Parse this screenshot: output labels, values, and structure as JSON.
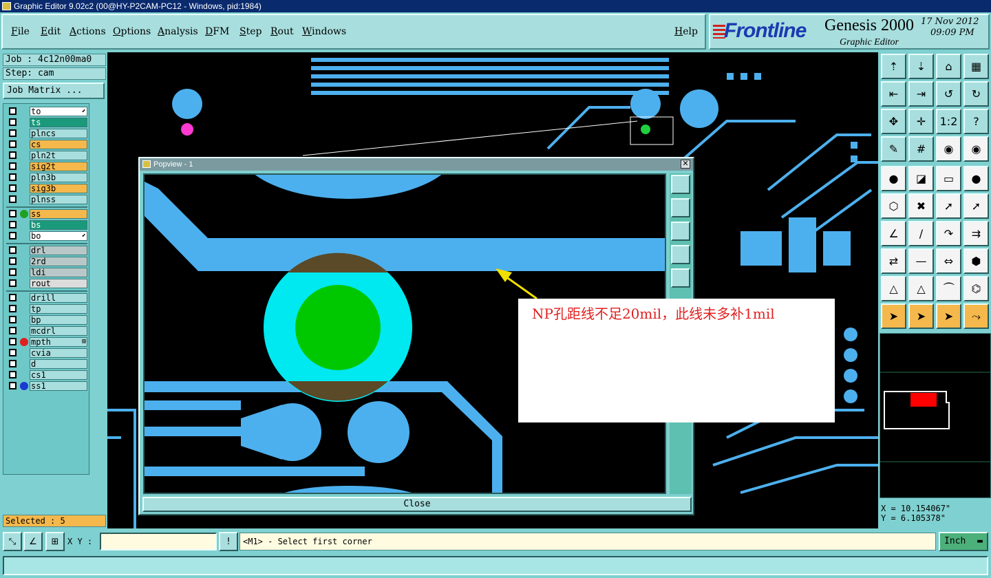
{
  "window": {
    "title": "Graphic Editor 9.02c2 (00@HY-P2CAM-PC12 - Windows, pid:1984)"
  },
  "menu": {
    "items": [
      "File",
      "Edit",
      "Actions",
      "Options",
      "Analysis",
      "DFM",
      "Step",
      "Rout",
      "Windows"
    ],
    "help": "Help"
  },
  "brand": {
    "logo": "Frontline",
    "product": "Genesis 2000",
    "subtitle": "Graphic Editor",
    "date": "17 Nov 2012",
    "time": "09:09 PM"
  },
  "job": {
    "job_label": "Job : 4c12n00ma0",
    "step_label": "Step: cam",
    "matrix_button": "Job Matrix ..."
  },
  "layers": [
    {
      "name": "to",
      "style": "white",
      "dot": "",
      "marker": "⬋"
    },
    {
      "name": "ts",
      "style": "green",
      "dot": "",
      "marker": ""
    },
    {
      "name": "plncs",
      "style": "",
      "dot": "",
      "marker": ""
    },
    {
      "name": "cs",
      "style": "orange",
      "dot": "",
      "marker": ""
    },
    {
      "name": "pln2t",
      "style": "",
      "dot": "",
      "marker": ""
    },
    {
      "name": "sig2t",
      "style": "orange",
      "dot": "",
      "marker": ""
    },
    {
      "name": "pln3b",
      "style": "",
      "dot": "",
      "marker": ""
    },
    {
      "name": "sig3b",
      "style": "orange",
      "dot": "",
      "marker": ""
    },
    {
      "name": "plnss",
      "style": "",
      "dot": "",
      "marker": ""
    },
    {
      "name": "ss",
      "style": "orange",
      "dot": "#20a020",
      "marker": ""
    },
    {
      "name": "bs",
      "style": "green",
      "dot": "",
      "marker": ""
    },
    {
      "name": "bo",
      "style": "white",
      "dot": "",
      "marker": "⬋"
    },
    {
      "name": "drl",
      "style": "gray",
      "dot": "",
      "marker": ""
    },
    {
      "name": "2rd",
      "style": "gray",
      "dot": "",
      "marker": ""
    },
    {
      "name": "ldi",
      "style": "gray",
      "dot": "",
      "marker": ""
    },
    {
      "name": "rout",
      "style": "light",
      "dot": "",
      "marker": ""
    },
    {
      "name": "drill",
      "style": "",
      "dot": "",
      "marker": ""
    },
    {
      "name": "tp",
      "style": "",
      "dot": "",
      "marker": ""
    },
    {
      "name": "bp",
      "style": "",
      "dot": "",
      "marker": ""
    },
    {
      "name": "mcdrl",
      "style": "",
      "dot": "",
      "marker": ""
    },
    {
      "name": "mpth",
      "style": "",
      "dot": "#e02020",
      "marker": "⊞"
    },
    {
      "name": "cvia",
      "style": "",
      "dot": "",
      "marker": ""
    },
    {
      "name": "d",
      "style": "",
      "dot": "",
      "marker": ""
    },
    {
      "name": "cs1",
      "style": "",
      "dot": "",
      "marker": ""
    },
    {
      "name": "ss1",
      "style": "",
      "dot": "#1a3ad0",
      "marker": ""
    }
  ],
  "selected": "Selected : 5",
  "popview": {
    "title": "Popview - 1",
    "close_label": "Close",
    "close_glyph": "✕"
  },
  "annotation": {
    "text": "NP孔距线不足20mil，此线未多补1mil"
  },
  "toolbox": {
    "icons": [
      "open-job-icon",
      "save-icon",
      "home-icon",
      "zoom-window-icon",
      "import-icon",
      "export-icon",
      "undo-icon",
      "redo-icon",
      "fit-icon",
      "center-icon",
      "scale-1-2-icon",
      "help-icon",
      "measure-icon",
      "grid-icon",
      "pads-icon",
      "snap-pads-icon",
      "pad-select-icon",
      "polygon-icon",
      "ruler-icon",
      "pad-edit-icon",
      "connect-icon",
      "cross-icon",
      "move-icon",
      "rotate-icon",
      "angle-line-icon",
      "line-icon",
      "arc-icon",
      "flip-icon",
      "copy-icon",
      "trim-icon",
      "spacing-icon",
      "merge-icon",
      "triangle-icon",
      "triangle-arc-icon",
      "arc-fill-icon",
      "arc-cross-icon",
      "select-icon",
      "select-box-icon",
      "select-arrow-icon",
      "select-net-icon"
    ],
    "glyphs": [
      "⇡",
      "⇣",
      "⌂",
      "▦",
      "⇤",
      "⇥",
      "↺",
      "↻",
      "✥",
      "✛",
      "1:2",
      "?",
      "✎",
      "#",
      "◉",
      "◉",
      "●",
      "◪",
      "▭",
      "●",
      "⬡",
      "✖",
      "➚",
      "➚",
      "∠",
      "/",
      "↷",
      "⇉",
      "⇄",
      "—",
      "⇔",
      "⬢",
      "△",
      "△",
      "⏜",
      "⌬",
      "➤",
      "➤",
      "➤",
      "⤳"
    ]
  },
  "coords": {
    "x": "X = 10.154067\"",
    "y": "Y = 6.105378\""
  },
  "status": {
    "xy_label": "X Y :",
    "xy_value": "",
    "prompt": "<M1> - Select first corner",
    "unit": "Inch"
  },
  "colors": {
    "board_bg": "#000000",
    "copper": "#4db0ee",
    "pad_ring": "#00e8f0",
    "drill": "#00c800",
    "annotation_text": "#e02020",
    "arrow": "#f0e000"
  }
}
